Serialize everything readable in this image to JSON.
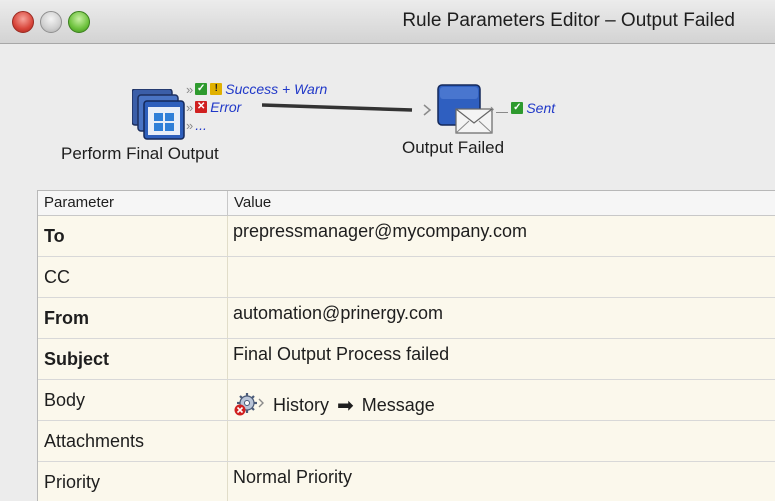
{
  "window": {
    "title": "Rule Parameters Editor – Output Failed"
  },
  "flow": {
    "source_node": {
      "label": "Perform Final Output",
      "icon": "window-stack-icon",
      "ports": [
        {
          "label": "Success + Warn",
          "status": [
            "ok",
            "warn"
          ]
        },
        {
          "label": "Error",
          "status": [
            "err"
          ]
        },
        {
          "label": "...",
          "status": []
        }
      ]
    },
    "target_node": {
      "label": "Output Failed",
      "icon": "envelope-icon",
      "ports": [
        {
          "label": "Sent",
          "status": [
            "ok"
          ]
        }
      ]
    }
  },
  "table": {
    "headers": {
      "parameter": "Parameter",
      "value": "Value"
    },
    "rows": [
      {
        "parameter": "To",
        "value": "prepressmanager@mycompany.com",
        "bold": true
      },
      {
        "parameter": "CC",
        "value": "",
        "bold": false
      },
      {
        "parameter": "From",
        "value": "automation@prinergy.com",
        "bold": true
      },
      {
        "parameter": "Subject",
        "value": "Final Output Process failed",
        "bold": true
      },
      {
        "parameter": "Body",
        "value_parts": [
          "History",
          "Message"
        ],
        "icon": "gear-error-icon",
        "bold": false
      },
      {
        "parameter": "Attachments",
        "value": "",
        "bold": false
      },
      {
        "parameter": "Priority",
        "value": "Normal Priority",
        "bold": false
      }
    ]
  },
  "colors": {
    "link_blue": "#2038c8",
    "row_background": "#fbf8ec",
    "ok_green": "#2e9a2e",
    "error_red": "#d02020",
    "warn_yellow": "#e0b000"
  }
}
